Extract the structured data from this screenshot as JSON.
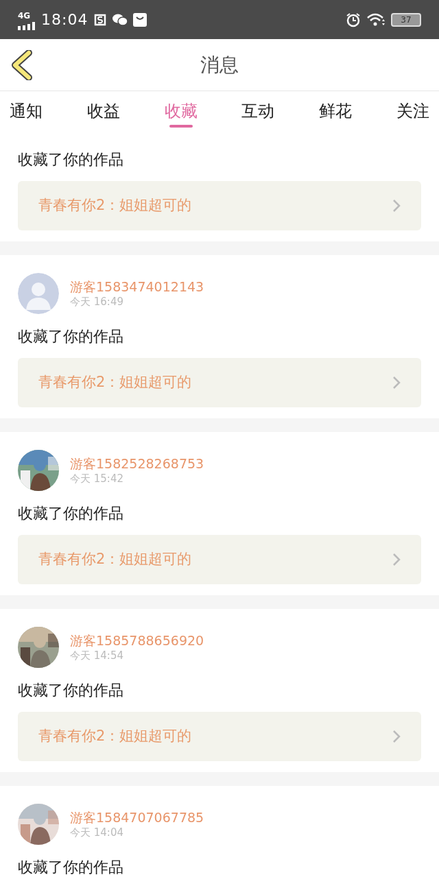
{
  "status_bar": {
    "network": "4G",
    "time": "18:04",
    "battery": "37"
  },
  "header": {
    "title": "消息"
  },
  "tabs": [
    {
      "label": "通知",
      "selected": false
    },
    {
      "label": "收益",
      "selected": false
    },
    {
      "label": "收藏",
      "selected": true
    },
    {
      "label": "互动",
      "selected": false
    },
    {
      "label": "鲜花",
      "selected": false
    },
    {
      "label": "关注",
      "selected": false
    }
  ],
  "messages": [
    {
      "action": "收藏了你的作品",
      "work": "青春有你2：姐姐超可的"
    },
    {
      "user": "游客1583474012143",
      "time": "今天 16:49",
      "avatar": {
        "kind": "default"
      },
      "action": "收藏了你的作品",
      "work": "青春有你2：姐姐超可的"
    },
    {
      "user": "游客1582528268753",
      "time": "今天 15:42",
      "action": "收藏了你的作品",
      "work": "青春有你2：姐姐超可的"
    },
    {
      "user": "游客1585788656920",
      "time": "今天 14:54",
      "action": "收藏了你的作品",
      "work": "青春有你2：姐姐超可的"
    },
    {
      "user": "游客1584707067785",
      "time": "今天 14:04",
      "action": "收藏了你的作品"
    }
  ]
}
